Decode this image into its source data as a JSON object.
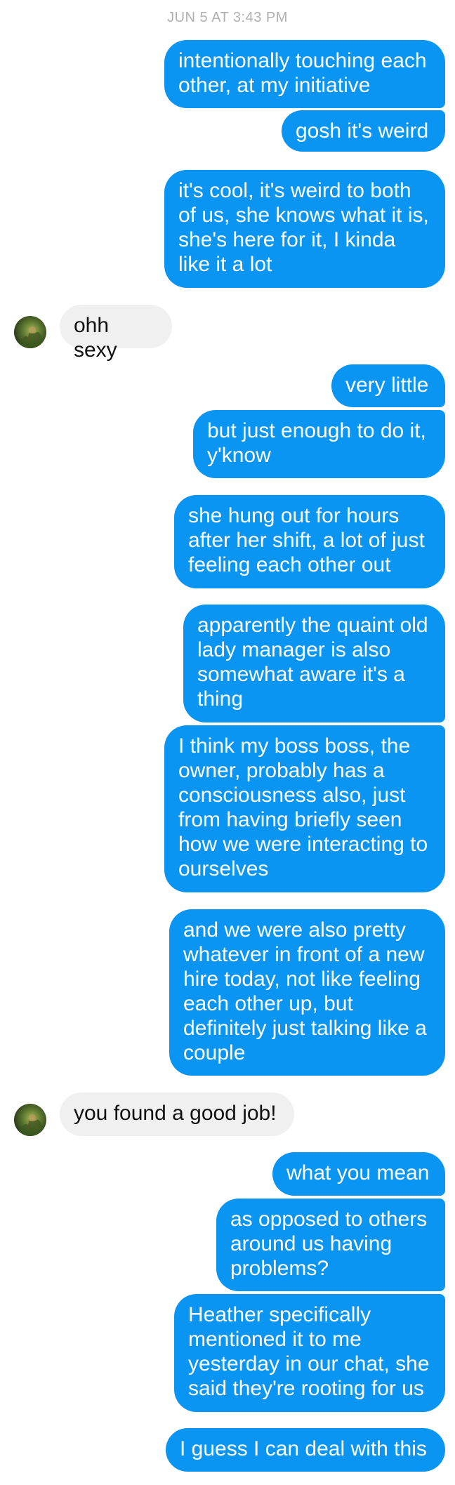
{
  "conversation": {
    "timestamp": "JUN 5 AT 3:43 PM",
    "messages": [
      {
        "from": "me",
        "text": "intentionally touching each other, at my initiative"
      },
      {
        "from": "me",
        "text": "gosh it's weird"
      },
      {
        "from": "me",
        "text": "it's cool, it's weird to both of us, she knows what it is, she's here for it, I kinda like it a lot"
      },
      {
        "from": "them",
        "text": "ohh sexy"
      },
      {
        "from": "me",
        "text": "very little"
      },
      {
        "from": "me",
        "text": "but just enough to do it, y'know"
      },
      {
        "from": "me",
        "text": "she hung out for hours after her shift, a lot of just feeling each other out"
      },
      {
        "from": "me",
        "text": "apparently the quaint old lady manager is also somewhat aware it's a thing"
      },
      {
        "from": "me",
        "text": "I think my boss boss, the owner, probably has a consciousness also, just from having briefly seen how we were interacting to ourselves"
      },
      {
        "from": "me",
        "text": "and we were also pretty whatever in front of a new hire today, not like feeling each other up, but definitely just talking like a couple"
      },
      {
        "from": "them",
        "text": "you found a good job!"
      },
      {
        "from": "me",
        "text": "what you mean"
      },
      {
        "from": "me",
        "text": "as opposed to others around us having problems?"
      },
      {
        "from": "me",
        "text": "Heather specifically mentioned it to me yesterday in our chat, she said they're rooting for us"
      },
      {
        "from": "me",
        "text": "I guess I can deal with this"
      }
    ]
  },
  "colors": {
    "outgoing_bubble": "#0a95f2",
    "incoming_bubble": "#f0f0f0",
    "timestamp": "#b0b0b0"
  },
  "icons": {
    "contact_avatar": "avatar-icon"
  }
}
